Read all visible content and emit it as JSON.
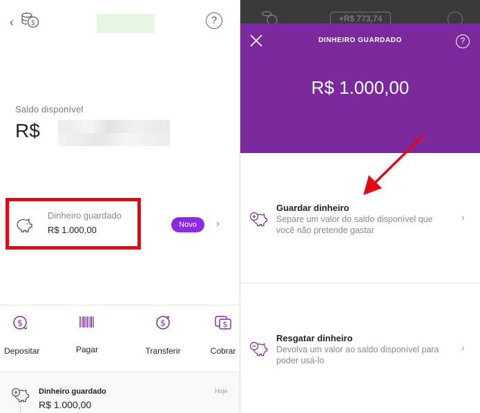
{
  "left": {
    "balance_label": "Saldo disponível",
    "balance_currency": "R$",
    "saved_money": {
      "label": "Dinheiro guardado",
      "value": "R$ 1.000,00",
      "badge": "Novo"
    },
    "actions": [
      {
        "label": "Depositar",
        "icon": "deposit-icon"
      },
      {
        "label": "Pagar",
        "icon": "barcode-icon"
      },
      {
        "label": "Transferir",
        "icon": "transfer-icon"
      },
      {
        "label": "Cobrar",
        "icon": "charge-icon"
      }
    ],
    "history": {
      "title": "Dinheiro guardado",
      "value": "R$ 1.000,00",
      "date": "Hoje"
    }
  },
  "right": {
    "top_badge": "+R$ 773,74",
    "header_title": "DINHEIRO GUARDADO",
    "amount": "R$ 1.000,00",
    "options": [
      {
        "title": "Guardar dinheiro",
        "description": "Separe um valor do saldo disponível que você não pretende gastar",
        "icon": "piggy-plus-icon"
      },
      {
        "title": "Resgatar dinheiro",
        "description": "Devolva um valor ao saldo disponível para poder usá-lo",
        "icon": "piggy-minus-icon"
      }
    ]
  },
  "colors": {
    "accent_purple": "#7b2a9e",
    "badge_purple": "#8a2be2",
    "highlight_red": "#e30613"
  }
}
